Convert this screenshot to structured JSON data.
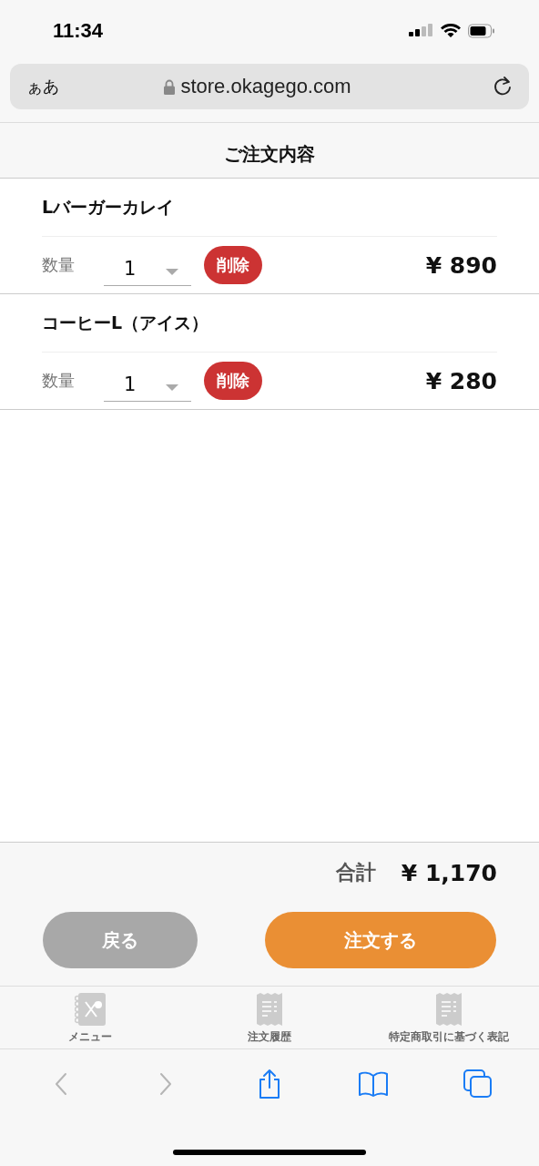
{
  "status_bar": {
    "time": "11:34"
  },
  "address_bar": {
    "text_size": "ぁあ",
    "url": "store.okagego.com"
  },
  "header": {
    "title": "ご注文内容"
  },
  "items": [
    {
      "name": "Lバーガーカレイ",
      "qty_label": "数量",
      "qty": "1",
      "delete": "削除",
      "price": "¥ 890"
    },
    {
      "name": "コーヒーL（アイス）",
      "qty_label": "数量",
      "qty": "1",
      "delete": "削除",
      "price": "¥ 280"
    }
  ],
  "total": {
    "label": "合計",
    "value": "¥ 1,170"
  },
  "buttons": [
    {
      "label": "戻る",
      "disabled": true
    },
    {
      "label": "注文する",
      "disabled": false
    }
  ],
  "tab_bar": [
    {
      "kind": "menu",
      "label": "メニュー"
    },
    {
      "kind": "receipt",
      "label": "注文履歴"
    },
    {
      "kind": "receipt",
      "label": "特定商取引に基づく表記"
    }
  ],
  "browser_toolbar": [
    {
      "kind": "back",
      "disabled": true
    },
    {
      "kind": "forward",
      "disabled": true
    },
    {
      "kind": "share",
      "disabled": false
    },
    {
      "kind": "bookmarks",
      "disabled": false
    },
    {
      "kind": "tabs",
      "disabled": false
    }
  ]
}
